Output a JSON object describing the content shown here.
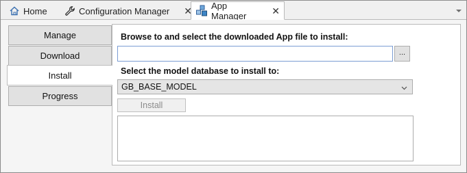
{
  "tabs": [
    {
      "label": "Home",
      "icon": "home-icon",
      "closable": false
    },
    {
      "label": "Configuration Manager",
      "icon": "wrench-icon",
      "closable": true
    },
    {
      "label": "App Manager",
      "icon": "app-manager-icon",
      "closable": true,
      "active": true
    }
  ],
  "close_glyph": "✕",
  "nav": {
    "items": [
      {
        "label": "Manage"
      },
      {
        "label": "Download"
      },
      {
        "label": "Install",
        "selected": true
      },
      {
        "label": "Progress"
      }
    ]
  },
  "install": {
    "browse_label": "Browse to and select the downloaded App file to install:",
    "file_path": "",
    "browse_button": "...",
    "model_label": "Select the model database to install to:",
    "model_selected": "GB_BASE_MODEL",
    "install_button": "Install",
    "log_text": ""
  },
  "colors": {
    "accent_border": "#7a9cd3",
    "disabled_text": "#8a8a8a"
  }
}
